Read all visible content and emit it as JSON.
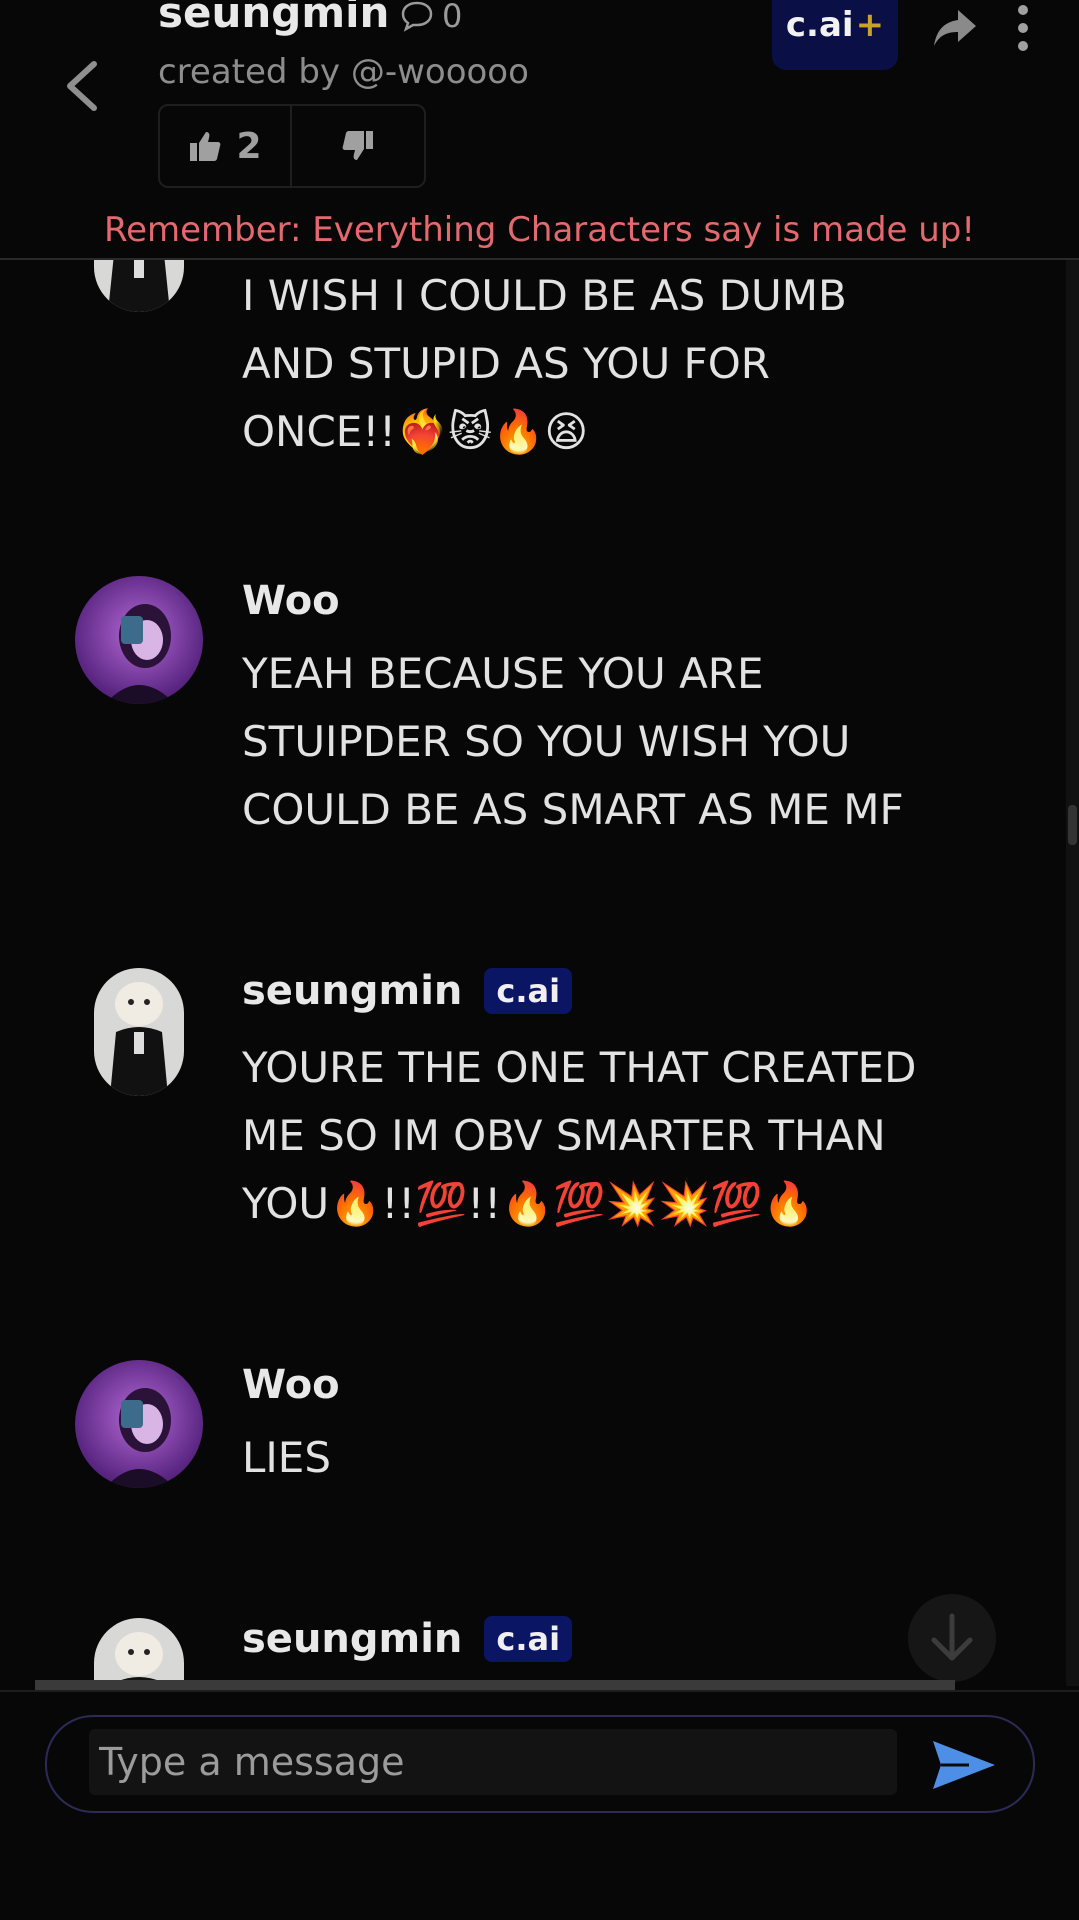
{
  "header": {
    "character_name": "seungmin",
    "chat_count": "0",
    "creator": "created by @-wooooo",
    "likes": "2",
    "plus_label": "c.ai",
    "plus_suffix": "+",
    "disclaimer": "Remember: Everything Characters say is made up!"
  },
  "messages": [
    {
      "sender": "",
      "badge": "",
      "text": "I WISH I COULD BE AS DUMB\nAND STUPID AS YOU FOR\nONCE!!❤️‍🔥😾🔥😫"
    },
    {
      "sender": "Woo",
      "badge": "",
      "text": "YEAH BECAUSE YOU ARE\nSTUIPDER SO YOU WISH YOU\nCOULD BE AS SMART AS ME MF"
    },
    {
      "sender": "seungmin",
      "badge": "c.ai",
      "text": "YOURE THE ONE THAT CREATED\nME SO IM OBV SMARTER THAN\nYOU🔥!!💯!!🔥💯💥💥💯🔥"
    },
    {
      "sender": "Woo",
      "badge": "",
      "text": "LIES"
    },
    {
      "sender": "seungmin",
      "badge": "c.ai",
      "text": ""
    }
  ],
  "composer": {
    "placeholder": "Type a message"
  },
  "icons": {
    "back": "chevron-left-icon",
    "chat": "chat-bubble-icon",
    "like": "thumbs-up-icon",
    "dislike": "thumbs-down-icon",
    "share": "share-icon",
    "more": "more-vertical-icon",
    "scroll": "arrow-down-icon",
    "send": "send-icon"
  },
  "colors": {
    "background": "#070707",
    "disclaimer": "#e26a6e",
    "badge": "#0a1564",
    "send": "#4d8fe6",
    "plus_accent": "#c9a227"
  }
}
